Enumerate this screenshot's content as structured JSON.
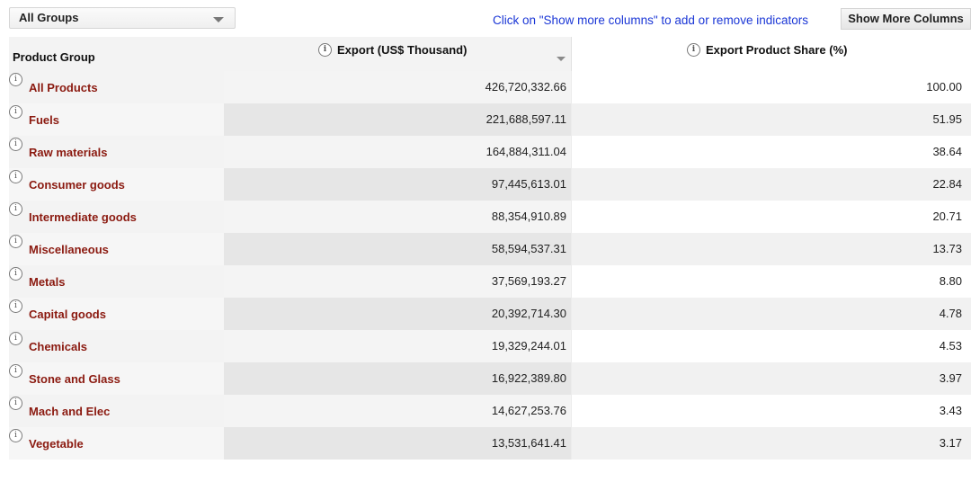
{
  "group_select": {
    "value": "All Groups"
  },
  "hint_text": "Click on \"Show more columns\" to add or remove indicators",
  "more_button": "Show More Columns",
  "headers": {
    "group": "Product Group",
    "export": "Export (US$ Thousand)",
    "share": "Export Product Share (%)"
  },
  "rows": [
    {
      "name": "All Products",
      "export": "426,720,332.66",
      "share": "100.00"
    },
    {
      "name": "Fuels",
      "export": "221,688,597.11",
      "share": "51.95"
    },
    {
      "name": "Raw materials",
      "export": "164,884,311.04",
      "share": "38.64"
    },
    {
      "name": "Consumer goods",
      "export": "97,445,613.01",
      "share": "22.84"
    },
    {
      "name": "Intermediate goods",
      "export": "88,354,910.89",
      "share": "20.71"
    },
    {
      "name": "Miscellaneous",
      "export": "58,594,537.31",
      "share": "13.73"
    },
    {
      "name": "Metals",
      "export": "37,569,193.27",
      "share": "8.80"
    },
    {
      "name": "Capital goods",
      "export": "20,392,714.30",
      "share": "4.78"
    },
    {
      "name": "Chemicals",
      "export": "19,329,244.01",
      "share": "4.53"
    },
    {
      "name": "Stone and Glass",
      "export": "16,922,389.80",
      "share": "3.97"
    },
    {
      "name": "Mach and Elec",
      "export": "14,627,253.76",
      "share": "3.43"
    },
    {
      "name": "Vegetable",
      "export": "13,531,641.41",
      "share": "3.17"
    }
  ]
}
